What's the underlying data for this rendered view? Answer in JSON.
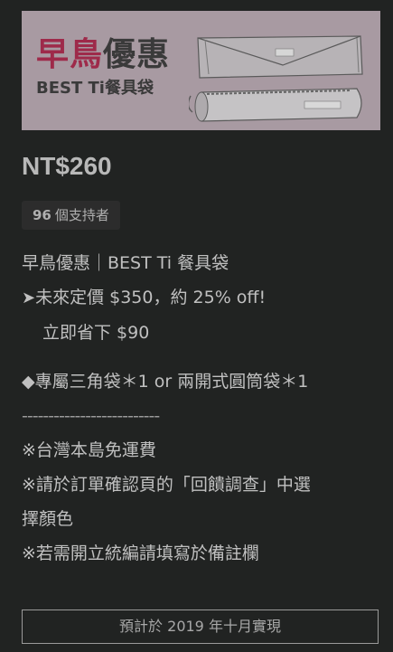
{
  "banner": {
    "title_accent": "早鳥",
    "title_rest": "優惠",
    "subtitle": "BEST Ti餐具袋",
    "product_label": "BESTTi"
  },
  "reward": {
    "price": "NT$260",
    "backers_count": "96",
    "backers_label": "個支持者",
    "desc_line1": "早鳥優惠｜BEST Ti 餐具袋",
    "desc_line2_arrow": "➤",
    "desc_line2": "未來定價 $350，約 25% off!",
    "desc_line3": "立即省下 $90",
    "desc_line4": "◆專屬三角袋＊1 or 兩開式圓筒袋＊1",
    "divider": "--------------------------",
    "note1": "※台灣本島免運費",
    "note2a": "※請於訂單確認頁的「回饋調查」中選",
    "note2b": "擇顏色",
    "note3": "※若需開立統編請填寫於備註欄",
    "cta": "預計於 2019 年十月實現"
  },
  "colors": {
    "background": "#212322",
    "banner_bg": "#a89aa2",
    "accent": "#9e2a4a"
  }
}
